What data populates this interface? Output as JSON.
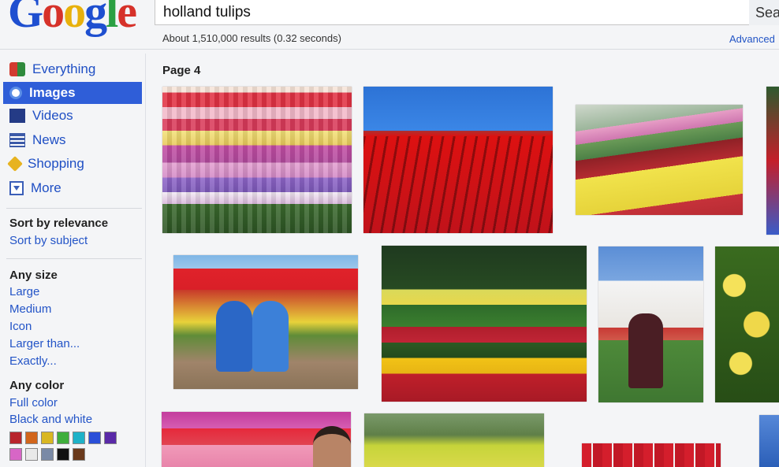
{
  "header": {
    "logo_letters": [
      "G",
      "o",
      "o",
      "g",
      "l",
      "e"
    ],
    "query": "holland tulips",
    "search_label": "Sea",
    "result_stats": "About 1,510,000 results (0.32 seconds)",
    "advanced_label": "Advanced"
  },
  "sidebar": {
    "nav": [
      {
        "label": "Everything",
        "icon": "everything-icon"
      },
      {
        "label": "Images",
        "icon": "images-icon",
        "active": true
      },
      {
        "label": "Videos",
        "icon": "videos-icon"
      },
      {
        "label": "News",
        "icon": "news-icon"
      },
      {
        "label": "Shopping",
        "icon": "shopping-icon"
      },
      {
        "label": "More",
        "icon": "more-icon"
      }
    ],
    "sort": {
      "relevance": "Sort by relevance",
      "subject": "Sort by subject"
    },
    "size": {
      "heading": "Any size",
      "options": [
        "Large",
        "Medium",
        "Icon",
        "Larger than...",
        "Exactly..."
      ]
    },
    "color": {
      "heading": "Any color",
      "options": [
        "Full color",
        "Black and white"
      ],
      "swatches": [
        "#b8242c",
        "#d2661c",
        "#d9b722",
        "#3fae3c",
        "#1eb2c8",
        "#2a4fd8",
        "#5a2aa8",
        "#d766c6",
        "#e9e9e9",
        "#7a8aa6",
        "#111111",
        "#6a3a1c"
      ]
    }
  },
  "main": {
    "page_label": "Page 4"
  }
}
